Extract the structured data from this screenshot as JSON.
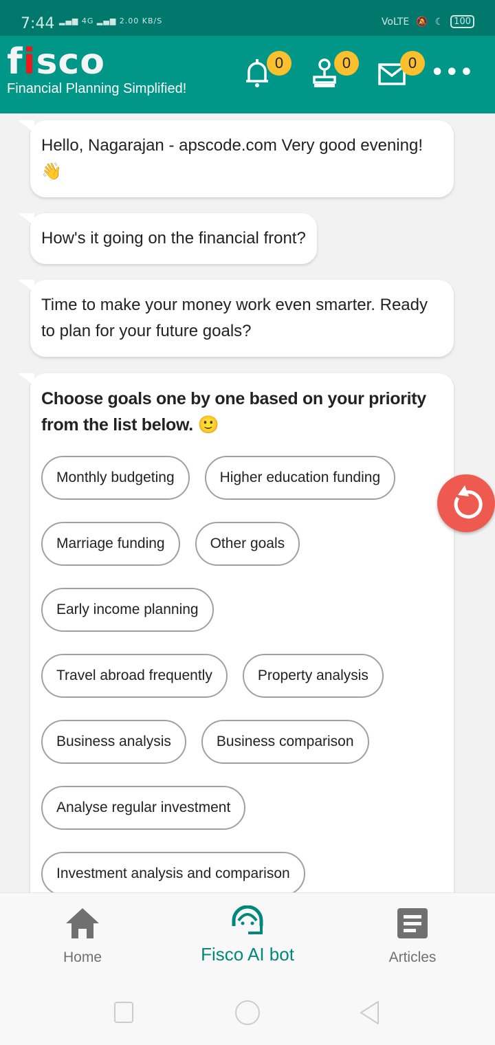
{
  "status_bar": {
    "time": "7:44",
    "network": "4G",
    "speed": "2.00 KB/S",
    "carrier": "VoLTE",
    "battery": "100"
  },
  "header": {
    "logo": "fisco",
    "tagline": "Financial Planning Simplified!",
    "notifications_count": "0",
    "profile_count": "0",
    "messages_count": "0",
    "accent": "#009688"
  },
  "chat": {
    "messages": [
      "Hello, Nagarajan - apscode.com Very good evening! 👋",
      "How's it going on the financial front?",
      "Time to make your money work even smarter. Ready to plan for your future goals?"
    ],
    "goals_prompt": "Choose goals one by one based on your priority from the list below. 🙂",
    "goals": [
      "Monthly budgeting",
      "Higher education funding",
      "Marriage funding",
      "Other goals",
      "Early income planning",
      "Travel abroad frequently",
      "Property analysis",
      "Business analysis",
      "Business comparison",
      "Analyse regular investment",
      "Investment analysis and comparison"
    ]
  },
  "bottom_nav": {
    "items": [
      {
        "label": "Home",
        "icon": "home-icon"
      },
      {
        "label": "Fisco AI bot",
        "icon": "headset-bot-icon",
        "active": true
      },
      {
        "label": "Articles",
        "icon": "article-icon"
      }
    ]
  }
}
